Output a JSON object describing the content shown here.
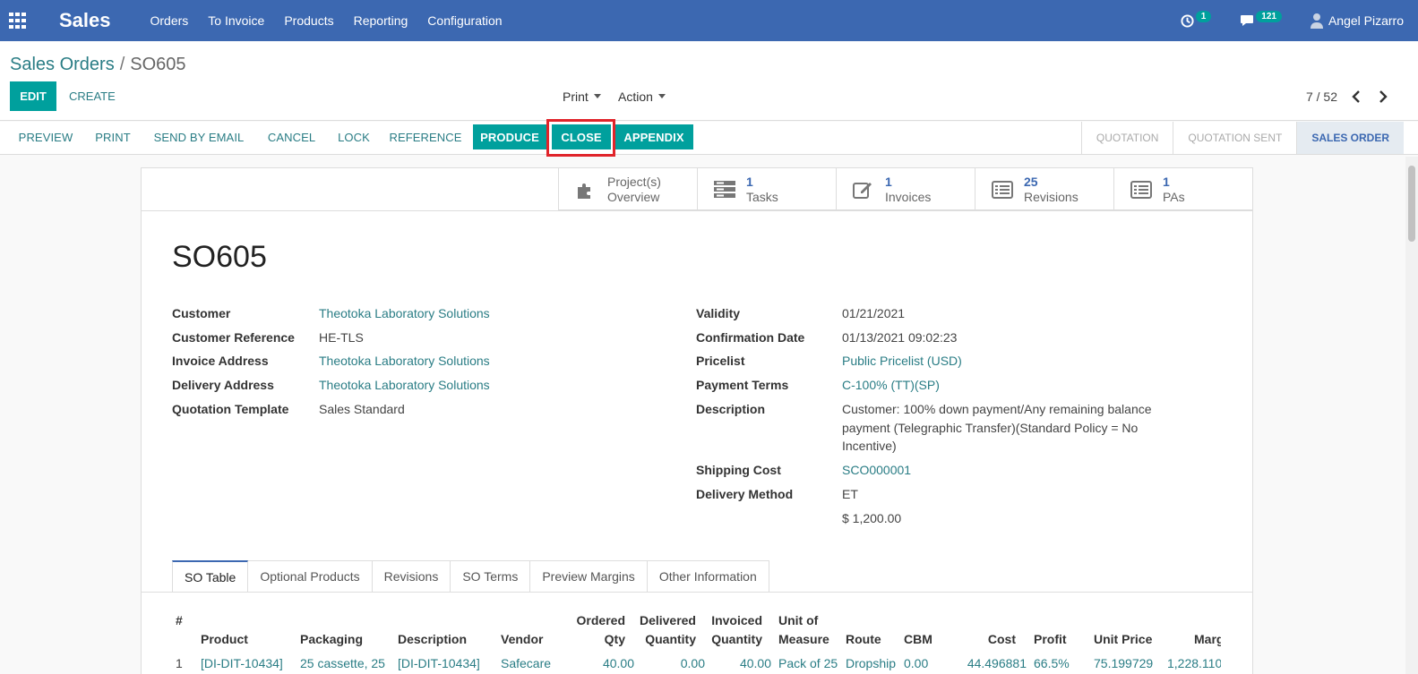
{
  "navbar": {
    "brand": "Sales",
    "menu": [
      "Orders",
      "To Invoice",
      "Products",
      "Reporting",
      "Configuration"
    ],
    "activity_count": "1",
    "messages_count": "121",
    "user_name": "Angel Pizarro"
  },
  "breadcrumb": {
    "parent": "Sales Orders",
    "separator": "/",
    "current": "SO605"
  },
  "controls": {
    "edit": "EDIT",
    "create": "CREATE",
    "print": "Print",
    "action": "Action",
    "pager": "7 / 52"
  },
  "statusbar": {
    "buttons": [
      "PREVIEW",
      "PRINT",
      "SEND BY EMAIL",
      "CANCEL",
      "LOCK",
      "REFERENCE",
      "PRODUCE",
      "CLOSE",
      "APPENDIX"
    ],
    "stages": [
      "QUOTATION",
      "QUOTATION SENT",
      "SALES ORDER"
    ]
  },
  "stat_buttons": [
    {
      "value": "",
      "label1": "Project(s)",
      "label2": "Overview",
      "icon": "puzzle-icon"
    },
    {
      "value": "1",
      "label1": "",
      "label2": "Tasks",
      "icon": "tasks-icon"
    },
    {
      "value": "1",
      "label1": "",
      "label2": "Invoices",
      "icon": "edit-icon"
    },
    {
      "value": "25",
      "label1": "",
      "label2": "Revisions",
      "icon": "list-icon"
    },
    {
      "value": "1",
      "label1": "",
      "label2": "PAs",
      "icon": "list-icon"
    }
  ],
  "order": {
    "name": "SO605",
    "left": [
      {
        "label": "Customer",
        "value": "Theotoka Laboratory Solutions"
      },
      {
        "label": "Customer Reference",
        "value": "HE-TLS"
      },
      {
        "label": "Invoice Address",
        "value": "Theotoka Laboratory Solutions"
      },
      {
        "label": "Delivery Address",
        "value": "Theotoka Laboratory Solutions"
      },
      {
        "label": "Quotation Template",
        "value": "Sales Standard"
      }
    ],
    "right": [
      {
        "label": "Validity",
        "value": "01/21/2021"
      },
      {
        "label": "Confirmation Date",
        "value": "01/13/2021 09:02:23"
      },
      {
        "label": "Pricelist",
        "value": "Public Pricelist (USD)"
      },
      {
        "label": "Payment Terms",
        "value": "C-100% (TT)(SP)"
      },
      {
        "label": "Description",
        "value_lines": [
          "Customer: 100% down payment/Any remaining balance",
          "payment (Telegraphic Transfer)(Standard Policy = No",
          "Incentive)"
        ]
      },
      {
        "label": "Shipping Cost",
        "value": "SCO000001"
      },
      {
        "label": "Delivery Method",
        "value": "ET"
      }
    ],
    "shipping_amount": "$ 1,200.00"
  },
  "tabs": [
    "SO Table",
    "Optional Products",
    "Revisions",
    "SO Terms",
    "Preview Margins",
    "Other Information"
  ],
  "table": {
    "headers": [
      {
        "l1": "",
        "l2": "#"
      },
      {
        "l1": "",
        "l2": "Product"
      },
      {
        "l1": "",
        "l2": "Packaging"
      },
      {
        "l1": "",
        "l2": "Description"
      },
      {
        "l1": "",
        "l2": "Vendor"
      },
      {
        "l1": "Ordered",
        "l2": "Qty"
      },
      {
        "l1": "Delivered",
        "l2": "Quantity"
      },
      {
        "l1": "Invoiced",
        "l2": "Quantity"
      },
      {
        "l1": "Unit of",
        "l2": "Measure"
      },
      {
        "l1": "",
        "l2": "Route"
      },
      {
        "l1": "",
        "l2": "CBM"
      },
      {
        "l1": "",
        "l2": "Cost"
      },
      {
        "l1": "",
        "l2": "Profit"
      },
      {
        "l1": "",
        "l2": "Unit Price"
      },
      {
        "l1": "",
        "l2": "Marg"
      }
    ],
    "rows": [
      [
        "1",
        "[DI-DIT-10434]",
        "25 cassette, 25",
        "[DI-DIT-10434]",
        "Safecare",
        "40.00",
        "0.00",
        "40.00",
        "Pack of 25",
        "Dropship",
        "0.00",
        "44.496881",
        "66.5%",
        "75.199729",
        "1,228.110"
      ]
    ]
  }
}
